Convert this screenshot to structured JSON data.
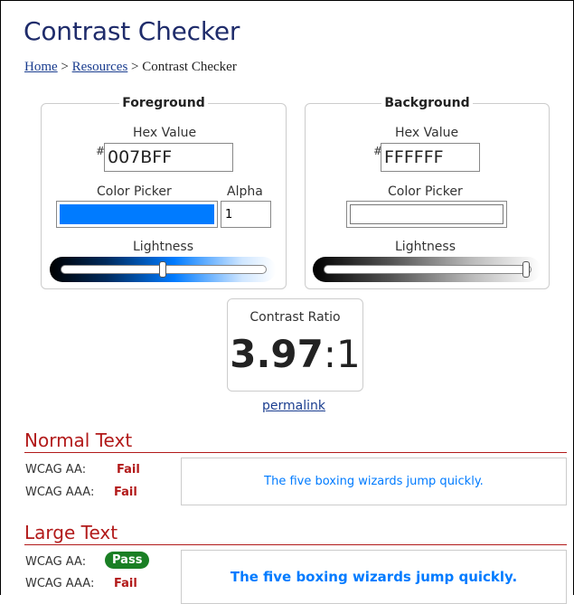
{
  "page": {
    "title": "Contrast Checker"
  },
  "breadcrumb": {
    "home": "Home",
    "sep1": " > ",
    "resources": "Resources",
    "sep2": " > ",
    "current": "Contrast Checker"
  },
  "foreground": {
    "legend": "Foreground",
    "hex_label": "Hex Value",
    "hash": "#",
    "hex_value": "007BFF",
    "picker_label": "Color Picker",
    "alpha_label": "Alpha",
    "alpha_value": "1",
    "lightness_label": "Lightness",
    "swatch_color": "#007BFF",
    "lightness_level": 0.5
  },
  "background": {
    "legend": "Background",
    "hex_label": "Hex Value",
    "hash": "#",
    "hex_value": "FFFFFF",
    "picker_label": "Color Picker",
    "lightness_label": "Lightness",
    "swatch_color": "#FFFFFF",
    "lightness_level": 1.0
  },
  "ratio": {
    "label": "Contrast Ratio",
    "value": "3.97",
    "suffix": ":1"
  },
  "permalink": "permalink",
  "normal_text": {
    "heading": "Normal Text",
    "aa_label": "WCAG AA:",
    "aa_result": "Fail",
    "aaa_label": "WCAG AAA:",
    "aaa_result": "Fail",
    "sample": "The five boxing wizards jump quickly."
  },
  "large_text": {
    "heading": "Large Text",
    "aa_label": "WCAG AA:",
    "aa_result": "Pass",
    "aaa_label": "WCAG AAA:",
    "aaa_result": "Fail",
    "sample": "The five boxing wizards jump quickly."
  },
  "colors": {
    "accent_red": "#b21a1a",
    "pass_green": "#1a7f24",
    "title_navy": "#1f2c6b",
    "link_blue": "#1a3d8f"
  }
}
